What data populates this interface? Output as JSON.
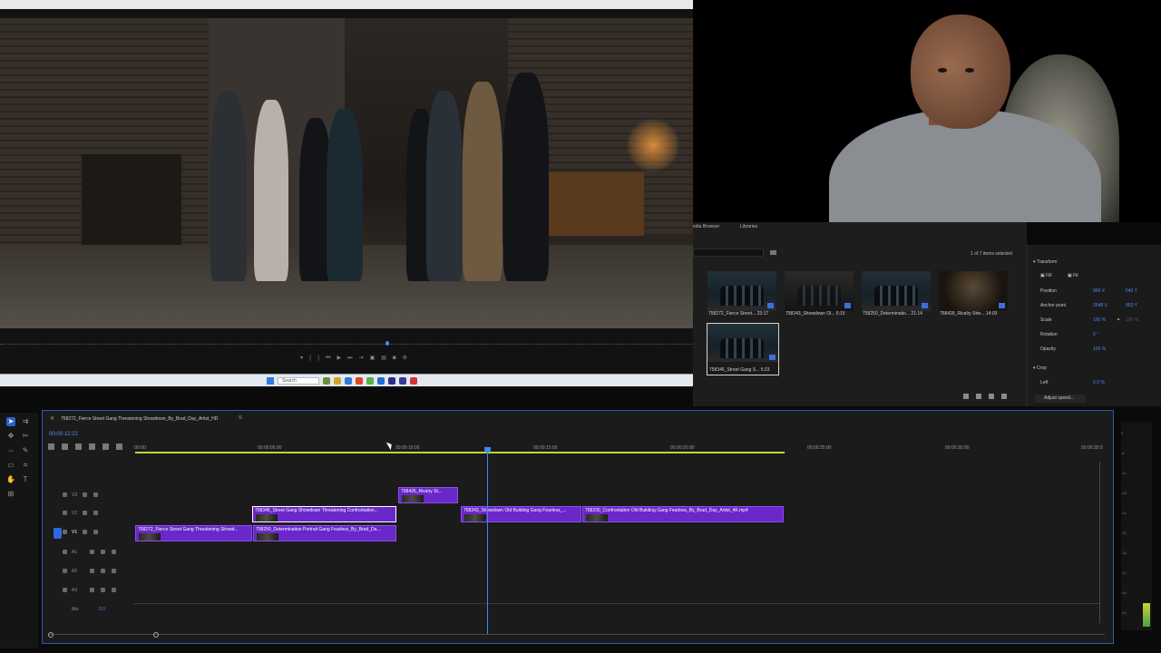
{
  "program": {
    "transport_icons": [
      "mark-in-icon",
      "mark-out-icon",
      "go-in-icon",
      "step-back-icon",
      "play-icon",
      "step-forward-icon",
      "go-out-icon",
      "insert-icon",
      "overwrite-icon",
      "export-frame-icon",
      "settings-icon"
    ],
    "marker_value": "1"
  },
  "taskbar": {
    "search_placeholder": "Search"
  },
  "project": {
    "tabs": [
      "edia Browser",
      "Libraries"
    ],
    "selected_count": "1 of 7 items selected",
    "items": [
      {
        "label": "758272_Fierce Street...",
        "duration": "23:17"
      },
      {
        "label": "758243_Showdown Ol...",
        "duration": "6:15"
      },
      {
        "label": "758250_Determinatio...",
        "duration": "21:14"
      },
      {
        "label": "758426_Rivalry Stre...",
        "duration": "14:03"
      },
      {
        "label": "758346_Street Gang S...",
        "duration": "5:23"
      }
    ]
  },
  "effects": {
    "section": "Transform",
    "fill": "Fill",
    "fit": "Fit",
    "position_label": "Position",
    "position_x": "960 X",
    "position_y": "540 Y",
    "anchor_label": "Anchor point",
    "anchor_x": "2048 X",
    "anchor_y": "853 Y",
    "scale_label": "Scale",
    "scale_val": "100 %",
    "scale_val2": "100 %",
    "rotation_label": "Rotation",
    "rotation_val": "0 °",
    "opacity_label": "Opacity",
    "opacity_val": "100 %",
    "crop_section": "Crop",
    "left_label": "Left",
    "left_val": "0.0 %",
    "adjust_speed": "Adjust speed..."
  },
  "timeline": {
    "sequence": "758272_Fierce Street Gang Threatening Showdown_By_Brad_Day_Artist_HD",
    "timecode": "00:00:12:22",
    "ticks": [
      ":00:00",
      "00:00:05:00",
      "00:00:10:00",
      "00:00:15:00",
      "00:00:20:00",
      "00:00:25:00",
      "00:00:30:00",
      "00:00:35:0"
    ],
    "tracks": {
      "v3": "V3",
      "v2": "V2",
      "v1": "V1",
      "v1_src": "V1",
      "a1": "A1",
      "a2": "A2",
      "a3": "A3",
      "mix": "Mix",
      "mix_val": "0.0"
    },
    "clips": {
      "v3_rivalry": "758426_Rivalry St...",
      "v2_street": "758346_Street Gang Showdown Threatening Confrontation...",
      "v2_showdown": "758243_Showdown Old Building Gang Fearless_...",
      "v2_confront": "758230_Confrontation Old Building Gang Fearless_By_Brad_Day_Artist_4K.mp4",
      "v1_fierce": "758272_Fierce Street Gang Threatening Showd...",
      "v1_determ": "758250_Determination Portrait Gang Fearless_By_Brad_Da..."
    }
  },
  "meter": {
    "db_labels": [
      "0",
      "-6",
      "-12",
      "-18",
      "-24",
      "-30",
      "-36",
      "-42",
      "-48",
      "-54"
    ]
  }
}
